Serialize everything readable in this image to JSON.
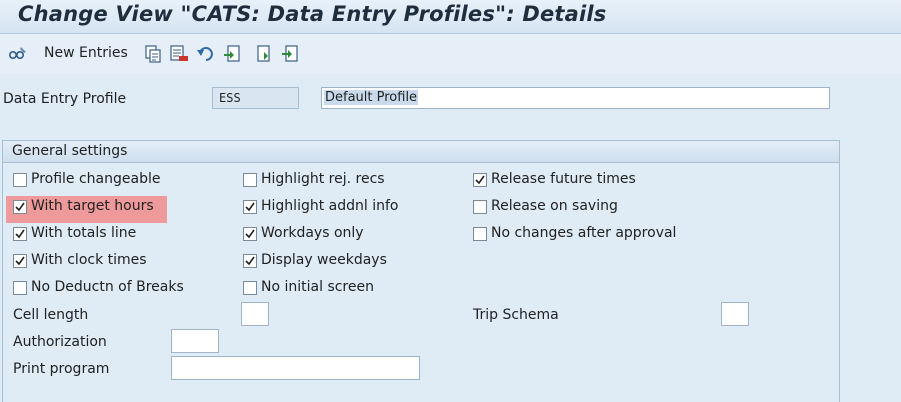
{
  "window": {
    "title": "Change View \"CATS: Data Entry Profiles\": Details"
  },
  "toolbar": {
    "new_entries_label": "New Entries",
    "icons": [
      "glasses-pencil-icon",
      "copy-icon",
      "delete-icon",
      "undo-icon",
      "select-all-icon",
      "previous-entry-icon",
      "next-entry-icon"
    ]
  },
  "profile": {
    "label": "Data Entry Profile",
    "code": "ESS",
    "description": "Default Profile"
  },
  "general": {
    "title": "General settings",
    "col1": [
      {
        "label": "Profile changeable",
        "checked": false
      },
      {
        "label": "With target hours",
        "checked": true
      },
      {
        "label": "With totals line",
        "checked": true
      },
      {
        "label": "With clock times",
        "checked": true
      },
      {
        "label": "No Deductn of Breaks",
        "checked": false
      }
    ],
    "col2": [
      {
        "label": "Highlight rej. recs",
        "checked": false
      },
      {
        "label": "Highlight addnl info",
        "checked": true
      },
      {
        "label": "Workdays only",
        "checked": true
      },
      {
        "label": "Display weekdays",
        "checked": true
      },
      {
        "label": "No initial screen",
        "checked": false
      }
    ],
    "col3": [
      {
        "label": "Release future times",
        "checked": true
      },
      {
        "label": "Release on saving",
        "checked": false
      },
      {
        "label": "No changes after approval",
        "checked": false
      }
    ],
    "cell_length_label": "Cell length",
    "cell_length_value": "",
    "trip_schema_label": "Trip Schema",
    "trip_schema_value": "",
    "authorization_label": "Authorization",
    "authorization_value": "",
    "print_program_label": "Print program",
    "print_program_value": ""
  }
}
